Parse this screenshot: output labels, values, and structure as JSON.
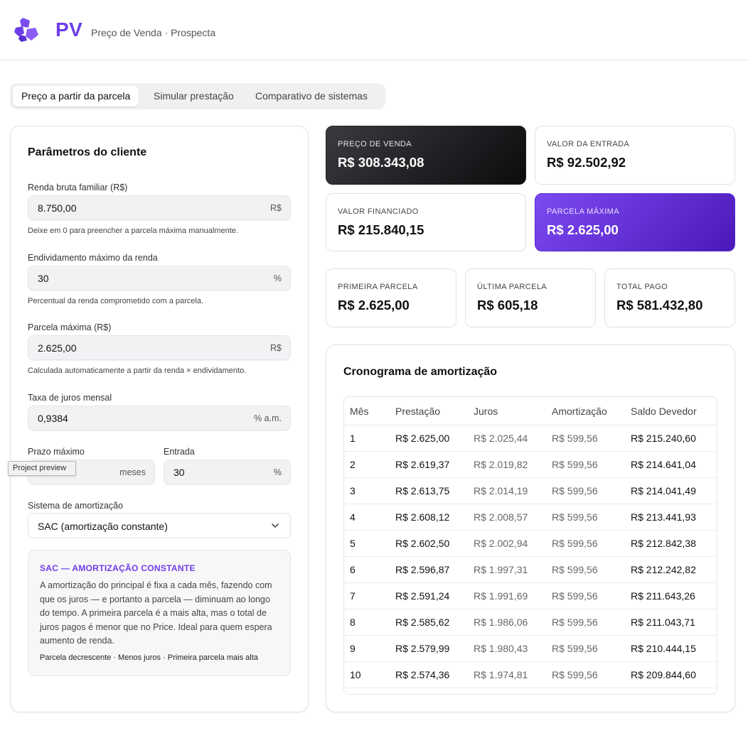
{
  "header": {
    "brand": "PV",
    "subtitle": "Preço de Venda · Prospecta",
    "logo_icon": "logo-icon"
  },
  "tabs": [
    {
      "label": "Preço a partir da parcela",
      "active": true
    },
    {
      "label": "Simular prestação",
      "active": false
    },
    {
      "label": "Comparativo de sistemas",
      "active": false
    }
  ],
  "form": {
    "title": "Parâmetros do cliente",
    "renda": {
      "label": "Renda bruta familiar (R$)",
      "value": "8.750,00",
      "unit": "R$",
      "hint": "Deixe em 0 para preencher a parcela máxima manualmente."
    },
    "endividamento": {
      "label": "Endividamento máximo da renda",
      "value": "30",
      "unit": "%",
      "hint": "Percentual da renda comprometido com a parcela."
    },
    "parcela": {
      "label": "Parcela máxima (R$)",
      "value": "2.625,00",
      "unit": "R$",
      "hint": "Calculada automaticamente a partir da renda × endividamento."
    },
    "taxa": {
      "label": "Taxa de juros mensal",
      "value": "0,9384",
      "unit": "% a.m."
    },
    "prazo": {
      "label": "Prazo máximo",
      "value": "",
      "unit": "meses"
    },
    "entrada": {
      "label": "Entrada",
      "value": "30",
      "unit": "%"
    },
    "sistema": {
      "label": "Sistema de amortização",
      "value": "SAC (amortização constante)"
    },
    "tooltip": "Project preview"
  },
  "info": {
    "title": "SAC — AMORTIZAÇÃO CONSTANTE",
    "body": "A amortização do principal é fixa a cada mês, fazendo com que os juros — e portanto a parcela — diminuam ao longo do tempo. A primeira parcela é a mais alta, mas o total de juros pagos é menor que no Price. Ideal para quem espera aumento de renda.",
    "footer": "Parcela decrescente · Menos juros · Primeira parcela mais alta"
  },
  "stats": {
    "preco_venda": {
      "label": "PREÇO DE VENDA",
      "value": "R$ 308.343,08"
    },
    "valor_entrada": {
      "label": "VALOR DA ENTRADA",
      "value": "R$ 92.502,92"
    },
    "valor_financiado": {
      "label": "VALOR FINANCIADO",
      "value": "R$ 215.840,15"
    },
    "parcela_maxima": {
      "label": "PARCELA MÁXIMA",
      "value": "R$ 2.625,00"
    },
    "primeira_parcela": {
      "label": "PRIMEIRA PARCELA",
      "value": "R$ 2.625,00"
    },
    "ultima_parcela": {
      "label": "ÚLTIMA PARCELA",
      "value": "R$ 605,18"
    },
    "total_pago": {
      "label": "TOTAL PAGO",
      "value": "R$ 581.432,80"
    }
  },
  "table": {
    "title": "Cronograma de amortização",
    "headers": [
      "Mês",
      "Prestação",
      "Juros",
      "Amortização",
      "Saldo Devedor"
    ],
    "rows": [
      [
        "1",
        "R$ 2.625,00",
        "R$ 2.025,44",
        "R$ 599,56",
        "R$ 215.240,60"
      ],
      [
        "2",
        "R$ 2.619,37",
        "R$ 2.019,82",
        "R$ 599,56",
        "R$ 214.641,04"
      ],
      [
        "3",
        "R$ 2.613,75",
        "R$ 2.014,19",
        "R$ 599,56",
        "R$ 214.041,49"
      ],
      [
        "4",
        "R$ 2.608,12",
        "R$ 2.008,57",
        "R$ 599,56",
        "R$ 213.441,93"
      ],
      [
        "5",
        "R$ 2.602,50",
        "R$ 2.002,94",
        "R$ 599,56",
        "R$ 212.842,38"
      ],
      [
        "6",
        "R$ 2.596,87",
        "R$ 1.997,31",
        "R$ 599,56",
        "R$ 212.242,82"
      ],
      [
        "7",
        "R$ 2.591,24",
        "R$ 1.991,69",
        "R$ 599,56",
        "R$ 211.643,26"
      ],
      [
        "8",
        "R$ 2.585,62",
        "R$ 1.986,06",
        "R$ 599,56",
        "R$ 211.043,71"
      ],
      [
        "9",
        "R$ 2.579,99",
        "R$ 1.980,43",
        "R$ 599,56",
        "R$ 210.444,15"
      ],
      [
        "10",
        "R$ 2.574,36",
        "R$ 1.974,81",
        "R$ 599,56",
        "R$ 209.844,60"
      ]
    ]
  },
  "colors": {
    "accent": "#6d3ee8",
    "dark_card": "#111111",
    "purple_card": "#5b21d6"
  }
}
